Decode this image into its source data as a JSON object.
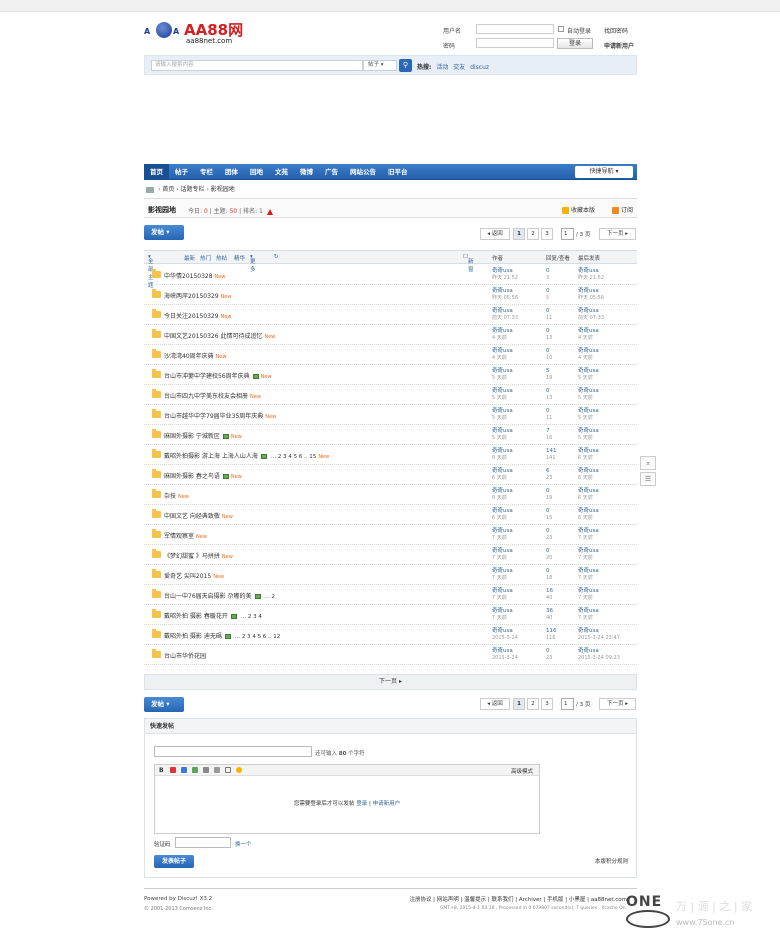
{
  "header": {
    "logo_left": "A",
    "logo_right": "A",
    "logo_brand": "AA88网",
    "logo_url": "aa88net.com",
    "username_label": "用户名",
    "password_label": "密码",
    "auto_login": "自动登录",
    "forgot_password": "找回密码",
    "login_button": "登录",
    "register": "申请新用户"
  },
  "search": {
    "placeholder": "请输入搜索内容",
    "type": "帖子",
    "hot_label": "热搜:",
    "hot": [
      "活动",
      "交友",
      "discuz"
    ]
  },
  "nav": {
    "items": [
      "首页",
      "帖子",
      "专栏",
      "团体",
      "回地",
      "文苑",
      "微博",
      "广告",
      "网站公告",
      "旧平台"
    ],
    "quick_nav": "快捷导航"
  },
  "breadcrumb": [
    "首页",
    "话题专栏",
    "影视园地"
  ],
  "forum": {
    "name": "影视园地",
    "today_label": "今日:",
    "today": "0",
    "topics_label": "主题:",
    "topics": "50",
    "rank_label": "排名:",
    "rank": "1",
    "favorite": "收藏本版",
    "subscribe": "订阅"
  },
  "post_button": "发帖",
  "pager": {
    "prev": "返回",
    "pages": [
      "1",
      "2",
      "3"
    ],
    "jump_value": "1",
    "total": "/ 3 页",
    "next": "下一页"
  },
  "table_head": {
    "all": "全部主题",
    "filters": [
      "最新",
      "热门",
      "热帖",
      "精华",
      "更多"
    ],
    "new_window": "新窗",
    "author": "作者",
    "replies": "回复/查看",
    "last": "最后发表"
  },
  "threads": [
    {
      "title": "中华情20150328",
      "new": "New",
      "img": false,
      "pages": "",
      "author": "奇奇usa",
      "author_time": "昨天 21:52",
      "replies": "0",
      "views": "3",
      "last_by": "奇奇usa",
      "last_time": "昨天 21:52"
    },
    {
      "title": "海峡两岸20150329",
      "new": "New",
      "img": false,
      "pages": "",
      "author": "奇奇usa",
      "author_time": "昨天 05:56",
      "replies": "0",
      "views": "5",
      "last_by": "奇奇usa",
      "last_time": "昨天 05:56"
    },
    {
      "title": "今日关注20150329",
      "new": "New",
      "img": false,
      "pages": "",
      "author": "奇奇usa",
      "author_time": "前天 07:33",
      "replies": "0",
      "views": "11",
      "last_by": "奇奇usa",
      "last_time": "前天 07:33"
    },
    {
      "title": "中国文艺20150326 此情可待成追忆",
      "new": "New",
      "img": false,
      "pages": "",
      "author": "奇奇usa",
      "author_time": "4 天前",
      "replies": "0",
      "views": "13",
      "last_by": "奇奇usa",
      "last_time": "4 天前"
    },
    {
      "title": "沙湾湾40周年庆典",
      "new": "New",
      "img": false,
      "pages": "",
      "author": "奇奇usa",
      "author_time": "4 天前",
      "replies": "0",
      "views": "10",
      "last_by": "奇奇usa",
      "last_time": "4 天前"
    },
    {
      "title": "台山市冲蒌中学建校56周年庆典",
      "new": "New",
      "img": true,
      "pages": "",
      "author": "奇奇usa",
      "author_time": "5 天前",
      "replies": "5",
      "views": "19",
      "last_by": "奇奇usa",
      "last_time": "5 天前"
    },
    {
      "title": "台山市四九中学美东校友会相册",
      "new": "New",
      "img": false,
      "pages": "",
      "author": "奇奇usa",
      "author_time": "5 天前",
      "replies": "0",
      "views": "13",
      "last_by": "奇奇usa",
      "last_time": "5 天前"
    },
    {
      "title": "台山市越华中学79届毕业35周年庆典",
      "new": "New",
      "img": false,
      "pages": "",
      "author": "奇奇usa",
      "author_time": "5 天前",
      "replies": "0",
      "views": "11",
      "last_by": "奇奇usa",
      "last_time": "5 天前"
    },
    {
      "title": "麻国外摄影 宁城新区",
      "new": "New",
      "img": true,
      "pages": "",
      "author": "奇奇usa",
      "author_time": "5 天前",
      "replies": "7",
      "views": "16",
      "last_by": "奇奇usa",
      "last_time": "5 天前"
    },
    {
      "title": "戴昭外拍摄影 游上海 上海人山人海",
      "new": "New",
      "img": true,
      "pages": "... 2 3 4 5 6 .. 15",
      "author": "奇奇usa",
      "author_time": "6 天前",
      "replies": "141",
      "views": "141",
      "last_by": "奇奇usa",
      "last_time": "6 天前"
    },
    {
      "title": "麻国外摄影 春之鸟语",
      "new": "New",
      "img": true,
      "pages": "",
      "author": "奇奇usa",
      "author_time": "6 天前",
      "replies": "6",
      "views": "23",
      "last_by": "奇奇usa",
      "last_time": "6 天前"
    },
    {
      "title": "杂技",
      "new": "New",
      "img": false,
      "pages": "",
      "author": "奇奇usa",
      "author_time": "6 天前",
      "replies": "0",
      "views": "19",
      "last_by": "奇奇usa",
      "last_time": "6 天前"
    },
    {
      "title": "中国文艺 向经典致敬",
      "new": "New",
      "img": false,
      "pages": "",
      "author": "奇奇usa",
      "author_time": "6 天前",
      "replies": "0",
      "views": "15",
      "last_by": "奇奇usa",
      "last_time": "6 天前"
    },
    {
      "title": "军情观察室",
      "new": "New",
      "img": false,
      "pages": "",
      "author": "奇奇usa",
      "author_time": "7 天前",
      "replies": "0",
      "views": "23",
      "last_by": "奇奇usa",
      "last_time": "7 天前"
    },
    {
      "title": "《梦幻甜蜜 》马拼拼",
      "new": "New",
      "img": false,
      "pages": "",
      "author": "奇奇usa",
      "author_time": "7 天前",
      "replies": "0",
      "views": "20",
      "last_by": "奇奇usa",
      "last_time": "7 天前"
    },
    {
      "title": "爱奇艺 尖叫2015",
      "new": "New",
      "img": false,
      "pages": "",
      "author": "奇奇usa",
      "author_time": "7 天前",
      "replies": "0",
      "views": "18",
      "last_by": "奇奇usa",
      "last_time": "7 天前"
    },
    {
      "title": "台山一中76届天启摄影 尕嘟的美",
      "new": "",
      "img": true,
      "pages": "... 2",
      "author": "奇奇usa",
      "author_time": "7 天前",
      "replies": "16",
      "views": "40",
      "last_by": "奇奇usa",
      "last_time": "7 天前"
    },
    {
      "title": "戴昭外拍 摄影 春暖花开",
      "new": "",
      "img": true,
      "pages": "... 2 3 4",
      "author": "奇奇usa",
      "author_time": "7 天前",
      "replies": "36",
      "views": "40",
      "last_by": "奇奇usa",
      "last_time": "7 天前"
    },
    {
      "title": "戴昭外拍 摄影 迪无碼",
      "new": "",
      "img": true,
      "pages": "... 2 3 4 5 6 .. 12",
      "author": "奇奇usa",
      "author_time": "2015-3-24",
      "replies": "116",
      "views": "116",
      "last_by": "奇奇usa",
      "last_time": "2015-3-24 23:47"
    },
    {
      "title": "台山市华侨花园",
      "new": "",
      "img": false,
      "pages": "",
      "author": "奇奇usa",
      "author_time": "2015-3-24",
      "replies": "0",
      "views": "23",
      "last_by": "奇奇usa",
      "last_time": "2015-3-24 09:23"
    }
  ],
  "next_page_bar": "下一页 ▸",
  "side_buttons": [
    "⌅",
    "☰"
  ],
  "quick_post": {
    "title": "快速发帖",
    "limit_prefix": "还可输入",
    "limit_count": "80",
    "limit_suffix": "个字符",
    "advanced": "高级模式",
    "msg_prefix": "您需要登录后才可以发帖",
    "login": "登录",
    "sep": "|",
    "register": "申请新用户",
    "verify_label": "验证码",
    "change": "换一个",
    "submit": "发表帖子",
    "rules": "本版积分规则"
  },
  "footer": {
    "powered": "Powered by Discuz! X3.2",
    "copyright": "© 2001-2013 Comsenz Inc.",
    "links": "注册协议 | 网站声明 | 温馨提示 | 联系我们 | Archiver | 手机版 | 小黑屋 | aa88net.com",
    "gmt": "GMT+8, 2015-4-1 03:18 , Processed in 0.079807 second(s), 7 queries , Xcache On."
  },
  "watermark": {
    "one": "ONE",
    "cn": "万 | 源 | 之 | 家",
    "site": "www.75one.cn"
  }
}
